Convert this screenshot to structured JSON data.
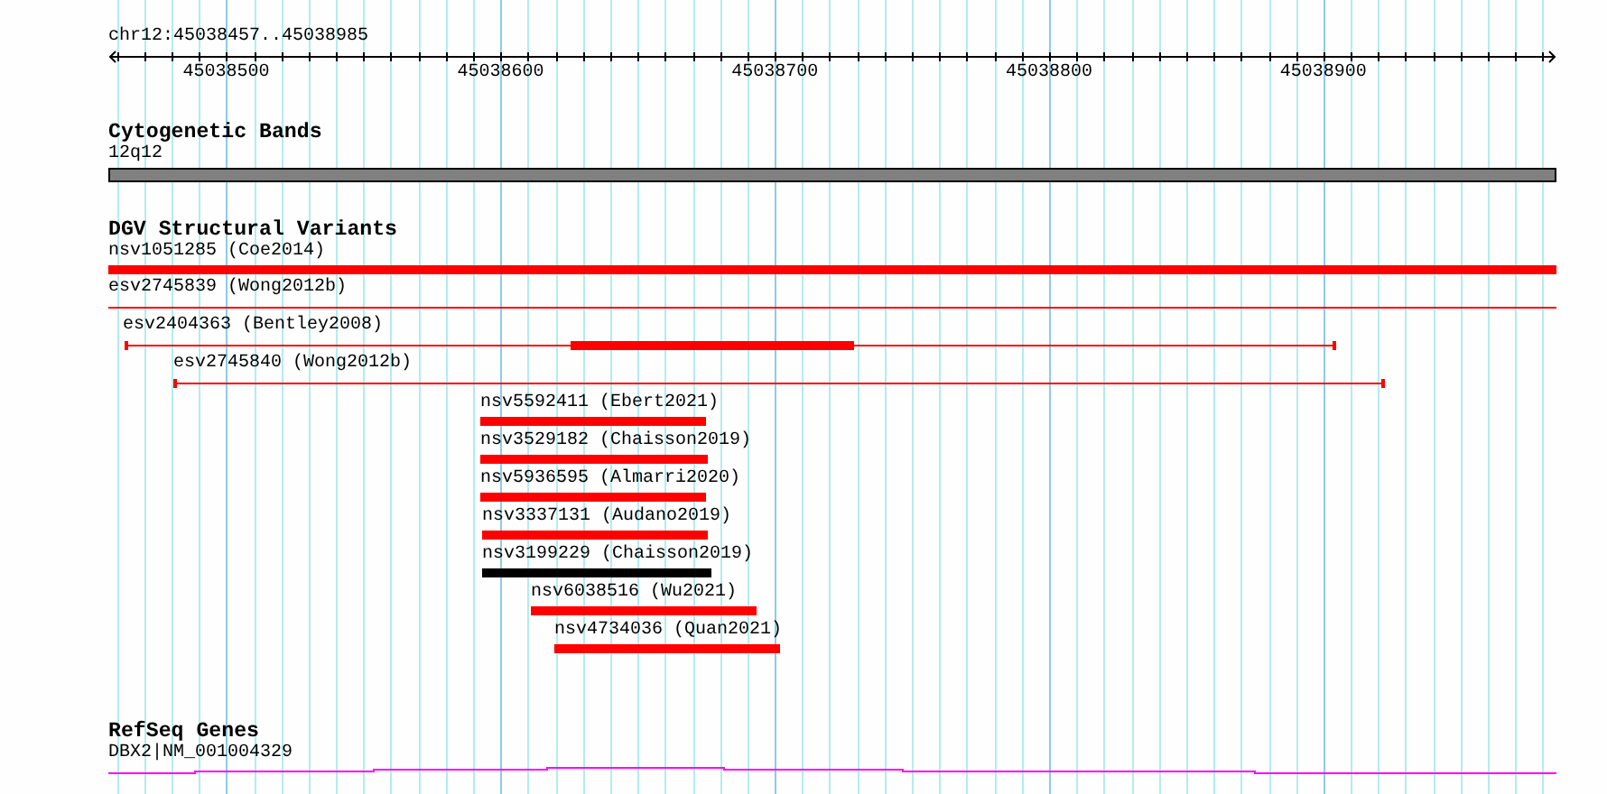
{
  "ruler": {
    "title": "chr12:45038457..45038985",
    "tick_labels": [
      "45038500",
      "45038600",
      "45038700",
      "45038800",
      "45038900"
    ]
  },
  "tracks": [
    {
      "title": "Cytogenetic Bands",
      "features": [
        {
          "label": "12q12",
          "kind": "band"
        }
      ]
    },
    {
      "title": "DGV Structural Variants",
      "features": [
        {
          "label": "nsv1051285 (Coe2014)",
          "kind": "bar",
          "color": "#ff0000"
        },
        {
          "label": "esv2745839 (Wong2012b)",
          "kind": "line",
          "color": "#ff0000"
        },
        {
          "label": "esv2404363 (Bentley2008)",
          "kind": "split",
          "color": "#ff0000"
        },
        {
          "label": "esv2745840 (Wong2012b)",
          "kind": "line",
          "color": "#ff0000"
        },
        {
          "label": "nsv5592411 (Ebert2021)",
          "kind": "bar",
          "color": "#ff0000"
        },
        {
          "label": "nsv3529182 (Chaisson2019)",
          "kind": "bar",
          "color": "#ff0000"
        },
        {
          "label": "nsv5936595 (Almarri2020)",
          "kind": "bar",
          "color": "#ff0000"
        },
        {
          "label": "nsv3337131 (Audano2019)",
          "kind": "bar",
          "color": "#ff0000"
        },
        {
          "label": "nsv3199229 (Chaisson2019)",
          "kind": "bar",
          "color": "#000000"
        },
        {
          "label": "nsv6038516 (Wu2021)",
          "kind": "bar",
          "color": "#ff0000"
        },
        {
          "label": "nsv4734036 (Quan2021)",
          "kind": "bar",
          "color": "#ff0000"
        }
      ]
    },
    {
      "title": "RefSeq Genes",
      "features": [
        {
          "label": "DBX2|NM_001004329",
          "kind": "gene"
        }
      ]
    }
  ]
}
